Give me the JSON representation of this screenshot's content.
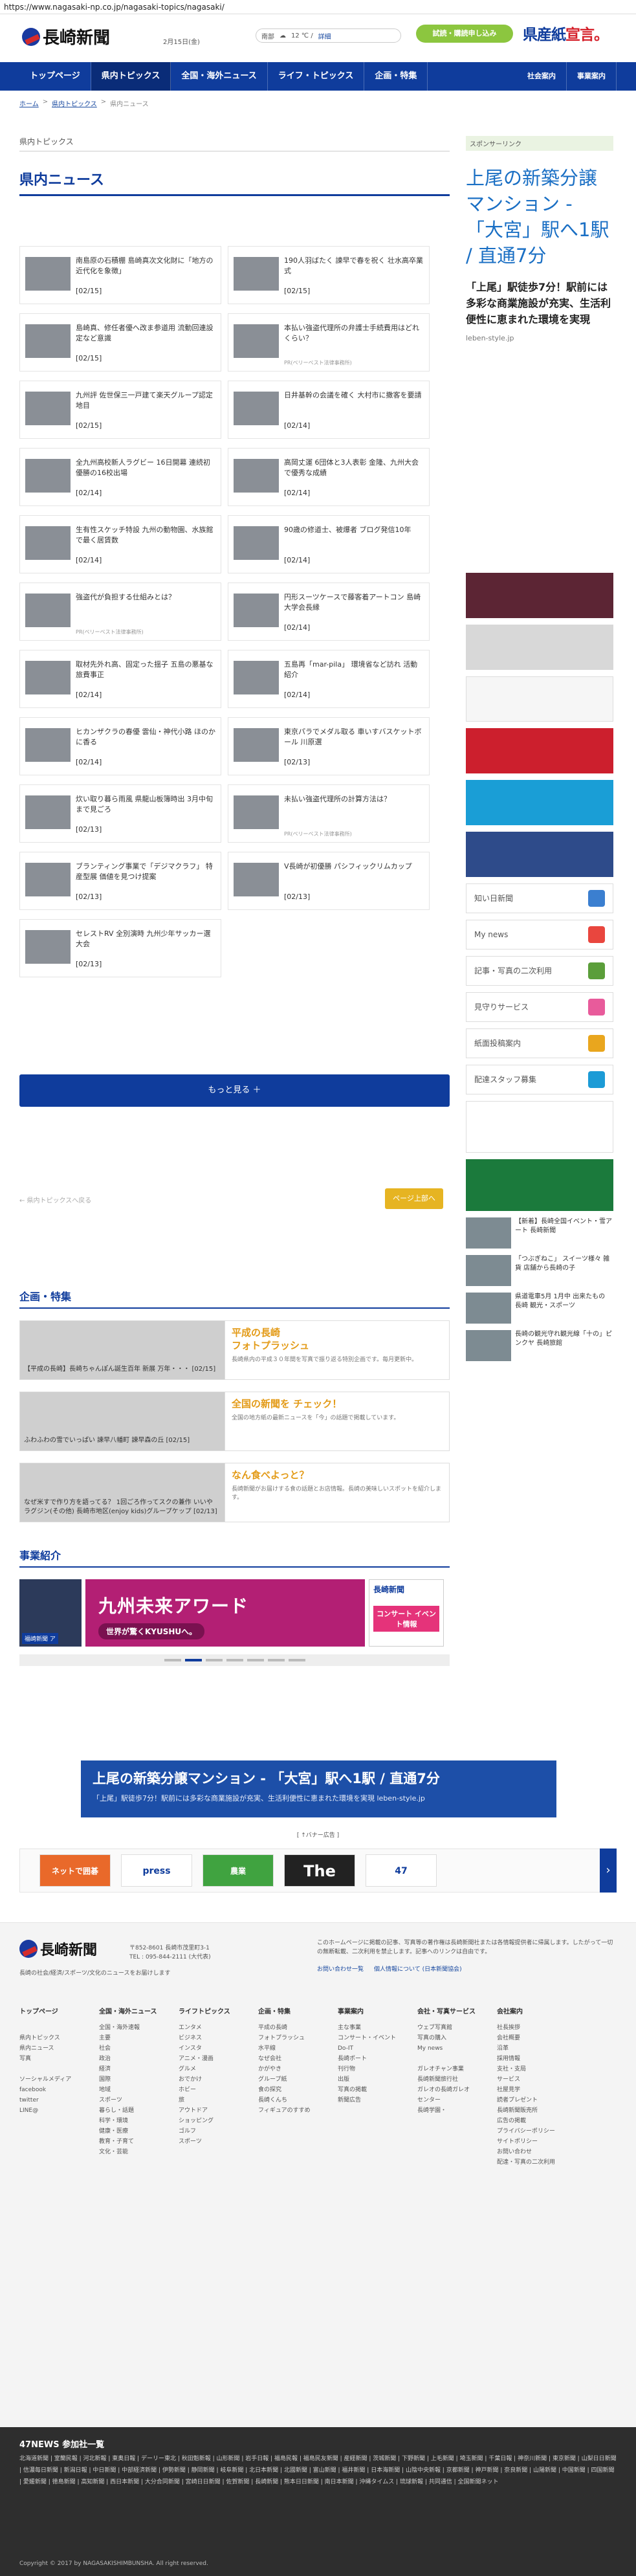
{
  "browser": {
    "url": "https://www.nagasaki-np.co.jp/nagasaki-topics/nagasaki/"
  },
  "header": {
    "logo": "長崎新聞",
    "date": "2月15日(金)",
    "weather": {
      "region": "南部",
      "temp": "12 ℃ /",
      "detail": "詳細"
    },
    "trial_button": "試読・購読申し込み",
    "banner_main": "県産紙",
    "banner_red": "宣言。"
  },
  "nav": {
    "items": [
      "トップページ",
      "県内トピックス",
      "全国・海外ニュース",
      "ライフ・トピックス",
      "企画・特集"
    ],
    "right_items": [
      "社会案内",
      "事業案内"
    ]
  },
  "breadcrumb": [
    "ホーム",
    "県内トピックス",
    "県内ニュース"
  ],
  "main": {
    "section_label": "県内トピックス",
    "page_title": "県内ニュース",
    "articles": [
      {
        "title": "南島原の石積棚 島崎真次文化財に「地方の近代化を象徴」",
        "date": "[02/15]",
        "pr": ""
      },
      {
        "title": "190人羽ばたく 諫早で春を祝く 壮水高卒業式",
        "date": "[02/15]",
        "pr": ""
      },
      {
        "title": "島崎真、修任者優へ改ま参道用 流動回連設定など意識",
        "date": "[02/15]",
        "pr": ""
      },
      {
        "title": "本払い強盗代理所の弁護士手続費用はどれくらい？",
        "date": "",
        "pr": "PR(ベリーベスト法律事務所)"
      },
      {
        "title": "九州評 佐世保三一戸建て楽天グループ認定地目",
        "date": "[02/15]",
        "pr": ""
      },
      {
        "title": "日井基幹の会議を確く 大村市に撒客を要請",
        "date": "[02/14]",
        "pr": ""
      },
      {
        "title": "全九州高校新人ラグビー 16日開幕 連続初優勝の16校出場",
        "date": "[02/14]",
        "pr": ""
      },
      {
        "title": "高岡丈運 6団体と3人表彰 金隆、九州大会で優秀な成績",
        "date": "[02/14]",
        "pr": ""
      },
      {
        "title": "生有性スケッチ特設 九州の動物園、水族館で最く居賃数",
        "date": "[02/14]",
        "pr": ""
      },
      {
        "title": "90歳の修道士、被爆者 ブログ発信10年",
        "date": "[02/14]",
        "pr": ""
      },
      {
        "title": "強盗代が負担する仕組みとは？",
        "date": "",
        "pr": "PR(ベリーベスト法律事務所)"
      },
      {
        "title": "円形スーツケースで藤客着アートコン 島崎大学会長縁",
        "date": "[02/14]",
        "pr": ""
      },
      {
        "title": "取材先外れ高、固定った揺子 五島の悪基な旅費事正",
        "date": "[02/14]",
        "pr": ""
      },
      {
        "title": "五島再「mar-pila」 環境省など訪れ 活動紹介",
        "date": "[02/14]",
        "pr": ""
      },
      {
        "title": "ヒカンザクラの春優 雲仙・神代小路 ほのかに香る",
        "date": "[02/14]",
        "pr": ""
      },
      {
        "title": "東京パラでメダル取る 車いすバスケットボール 川原選",
        "date": "[02/13]",
        "pr": ""
      },
      {
        "title": "炊い取り暮ら雨風 県龍山板簿時出 3月中旬まで見ごろ",
        "date": "[02/13]",
        "pr": ""
      },
      {
        "title": "未払い強盗代理所の計算方法は？",
        "date": "",
        "pr": "PR(ベリーベスト法律事務所)"
      },
      {
        "title": "ブランティング事業で「デジマクラフ」 特産型展 価値を見つけ提案",
        "date": "[02/13]",
        "pr": ""
      },
      {
        "title": "V長崎が初優勝 パシフィックリムカップ",
        "date": "[02/13]",
        "pr": ""
      },
      {
        "title": "セレストRV 全別演時 九州少年サッカー選大会",
        "date": "[02/13]",
        "pr": ""
      }
    ],
    "more_button": "もっと見る ＋",
    "prev_link": "← 県内トピックスへ戻る",
    "top_button": "ページ上部へ"
  },
  "features": {
    "heading": "企画・特集",
    "items": [
      {
        "caption": "【平成の長崎】長崎ちゃんぽん誕生百年 新展 万年・・・ [02/15]",
        "title": "平成の長崎\nフォトプラッシュ",
        "desc": "長崎県内の平成３０年間を写真で振り返る特別企画です。毎月更新中。"
      },
      {
        "caption": "ふわふわの雪でいっぱい 諫早八幡町 諫早森の丘 [02/15]",
        "title": "全国の新聞を チェック！",
        "desc": "全国の地方紙の最新ニュースを「今」の話題で掲載しています。"
      },
      {
        "caption": "なぜ米すで作り方を語ってる？ 1回ごろ作ってスクの兼作 いいやラグジン(その他) 長崎市地区(enjoy kids)グループケップ [02/13]",
        "title": "なん食べよっと？",
        "desc": "長崎新聞がお届けする食の話題とお店情報。長崎の美味しいスポットを紹介します。"
      }
    ]
  },
  "events": {
    "heading": "事業紹介",
    "left_label": "福崎新聞 ア",
    "big_title": "九州未来アワード",
    "big_sub": "世界が驚くKYUSHUへ。",
    "side_logo": "長崎新聞",
    "side_text": "コンサート イベント情報"
  },
  "ad_wide": {
    "line1": "上尾の新築分譲マンション - 「大宮」駅へ1駅 / 直通7分",
    "line2": "「上尾」駅徒歩7分！駅前には多彩な商業施設が充実、生活利便性に恵まれた環境を実現 leben-style.jp"
  },
  "ad_label": "[ ↑バナー広告 ]",
  "strip": [
    "ネットで囲碁",
    "press",
    "農業",
    "The Way",
    "47"
  ],
  "footer": {
    "logo": "長崎新聞",
    "address": "〒852-8601 長崎市茂里町3-1",
    "tel": "TEL : 095-844-2111 (大代表)",
    "subtitle": "長崎の社会/経済/スポーツ/文化のニュースをお届けします",
    "note": "このホームページに掲載の記事、写真等の著作権は長崎新聞社または各情報提供者に帰属します。したがって一切の無断転載、二次利用を禁止します。記事へのリンクは自由です。",
    "links": [
      "お問い合わせ一覧",
      "個人情報について (日本新聞協会)"
    ],
    "columns": [
      {
        "head": "トップページ",
        "items": [
          "",
          "県内トピックス",
          "県内ニュース",
          "写真",
          "",
          "ソーシャルメディア",
          "facebook",
          "twitter",
          "LINE@"
        ]
      },
      {
        "head": "全国・海外ニュース",
        "items": [
          "全国・海外速報",
          "主要",
          "社会",
          "政治",
          "経済",
          "国際",
          "地域",
          "スポーツ",
          "暮らし・話題",
          "科学・環境",
          "健康・医療",
          "教育・子育て",
          "文化・芸能"
        ]
      },
      {
        "head": "ライフトピックス",
        "items": [
          "エンタメ",
          "ビジネス",
          "インスタ",
          "アニメ・漫画",
          "グルメ",
          "おでかけ",
          "ホビー",
          "旅",
          "アウトドア",
          "ショッピング",
          "ゴルフ",
          "スポーツ"
        ]
      },
      {
        "head": "企画・特集",
        "items": [
          "平成の長崎",
          "フォトプラッシュ",
          "水平線",
          "なぜ会社",
          "かがやき",
          "グループ紙",
          "食の探究",
          "長崎くんち",
          "フィギュアのすすめ"
        ]
      },
      {
        "head": "事業案内",
        "items": [
          "主な事業",
          "コンサート・イベント",
          "Do-IT",
          "長崎ポート",
          "刊行物",
          "出版",
          "写真の掲載",
          "新聞広告"
        ]
      },
      {
        "head": "会社・写真サービス",
        "items": [
          "ウェブ写真館",
          "写真の購入",
          "My news",
          "",
          "ガレオチャン事業",
          "長崎新聞旅行社",
          "ガレオの長崎ガレオ",
          "センター",
          "長崎学園・"
        ]
      },
      {
        "head": "会社案内",
        "items": [
          "社長挨拶",
          "会社概要",
          "沿革",
          "採用情報",
          "支社・支局",
          "サービス",
          "社屋見学",
          "読者プレゼント",
          "長崎新聞販売所",
          "広告の掲載",
          "プライバシーポリシー",
          "サイトポリシー",
          "お問い合わせ",
          "配達・写真の二次利用"
        ]
      }
    ]
  },
  "news47": {
    "title": "47NEWS 参加社一覧",
    "papers": "北海道新聞 | 室蘭民報 | 河北新報 | 東奥日報 | デーリー東北 | 秋田魁新報 | 山形新聞 | 岩手日報 | 福島民報 | 福島民友新聞 | 産経新聞 | 茨城新聞 | 下野新聞 | 上毛新聞 | 埼玉新聞 | 千葉日報 | 神奈川新聞 | 東京新聞 | 山梨日日新聞 | 信濃毎日新聞 | 新潟日報 | 中日新聞 | 中部経済新聞 | 伊勢新聞 | 静岡新聞 | 岐阜新聞 | 北日本新聞 | 北國新聞 | 富山新聞 | 福井新聞 | 日本海新聞 | 山陰中央新報 | 京都新聞 | 神戸新聞 | 奈良新聞 | 山陽新聞 | 中国新聞 | 四国新聞 | 愛媛新聞 | 徳島新聞 | 高知新聞 | 西日本新聞 | 大分合同新聞 | 宮崎日日新聞 | 佐賀新聞 | 長崎新聞 | 熊本日日新聞 | 南日本新聞 | 沖縄タイムス | 琉球新報 | 共同通信 | 全国新聞ネット",
    "copyright": "Copyright © 2017 by NAGASAKISHIMBUNSHA. All right reserved."
  },
  "sidebar": {
    "sponsor": "スポンサーリンク",
    "ad_head": "上尾の新築分譲マンション - 「大宮」駅へ1駅 / 直通7分",
    "ad_body": "「上尾」駅徒歩7分！駅前には多彩な商業施設が充実、生活利便性に恵まれた環境を実現",
    "ad_url": "leben-style.jp",
    "links": [
      "知い日新聞",
      "My news",
      "記事・写真の二次利用",
      "見守りサービス",
      "紙面投稿案内",
      "配達スタッフ募集"
    ],
    "small_news": [
      "【新着】長崎全国イベント・雪アート 長崎新聞",
      "「つぶぎねこ」 スイーツ様々 雑貨 店舗から長崎の子",
      "県道電車5月 1月中 出来たもの 長崎 観光・スポーツ",
      "長崎の観光守れ観光線「十の」ピンクヤ 長崎旅館"
    ]
  },
  "colors": {
    "brand": "#0f3c9c",
    "accent_green": "#8cc63f",
    "accent_gold": "#e6b422",
    "feature_title": "#e39b18"
  }
}
